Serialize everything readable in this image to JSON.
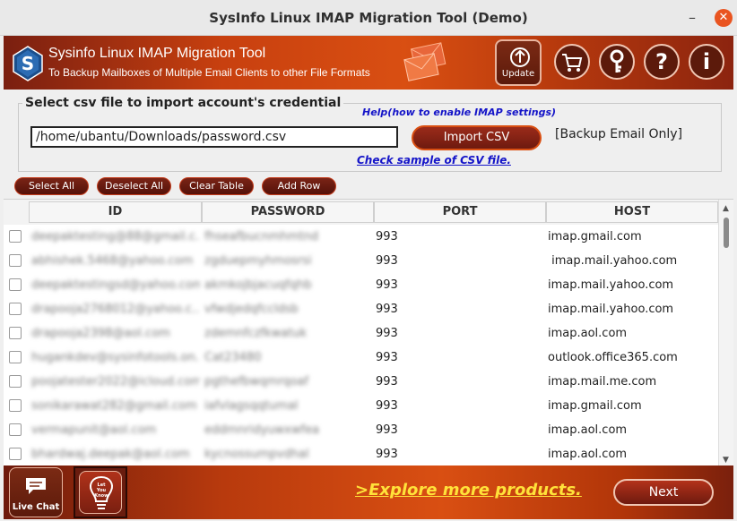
{
  "window": {
    "title": "SysInfo Linux IMAP Migration Tool (Demo)",
    "minimize_glyph": "–",
    "close_glyph": "✕"
  },
  "header": {
    "brand_title": "Sysinfo Linux IMAP Migration Tool",
    "brand_subtitle": "To Backup Mailboxes of Multiple Email Clients to other File Formats",
    "update_label": "Update",
    "cart_icon": "cart-icon",
    "key_icon": "key-icon",
    "help_icon": "help-icon",
    "info_icon": "info-icon",
    "help_glyph": "?",
    "info_glyph": "i"
  },
  "csv": {
    "group_title": "Select csv file to import account's credential",
    "help_link": "Help(how to enable IMAP settings)",
    "path_value": "/home/ubantu/Downloads/password.csv",
    "import_label": "Import CSV",
    "backup_label": "[Backup Email Only]",
    "sample_link": "Check sample of CSV file."
  },
  "actions": {
    "select_all": "Select All",
    "deselect_all": "Deselect All",
    "clear_table": "Clear Table",
    "add_row": "Add Row"
  },
  "table": {
    "columns": [
      "ID",
      "PASSWORD",
      "PORT",
      "HOST"
    ],
    "rows": [
      {
        "id": "deepaktesting@88@gmail.c...",
        "password": "fhseafbucnmhmtnd",
        "port": "993",
        "host": "imap.gmail.com"
      },
      {
        "id": "abhishek.5468@yahoo.com",
        "password": "zgduepmyhmosrsi",
        "port": "993",
        "host": " imap.mail.yahoo.com"
      },
      {
        "id": "deepaktestingsd@yahoo.com",
        "password": "akmkojbjacuqfqhb",
        "port": "993",
        "host": "imap.mail.yahoo.com"
      },
      {
        "id": "drapooja2768012@yahoo.c...",
        "password": "vfwdjedqfccldsb",
        "port": "993",
        "host": "imap.mail.yahoo.com"
      },
      {
        "id": "drapooja2398@aol.com",
        "password": "zdemnfczfkwatuk",
        "port": "993",
        "host": "imap.aol.com"
      },
      {
        "id": "hugankdev@sysinfotools.on...",
        "password": "Cat23480",
        "port": "993",
        "host": "outlook.office365.com"
      },
      {
        "id": "poojatester2022@icloud.com",
        "password": "pgthefbwqmrqoaf",
        "port": "993",
        "host": "imap.mail.me.com"
      },
      {
        "id": "sonikarawat282@gmail.com",
        "password": "iafvlagsqqtumal",
        "port": "993",
        "host": "imap.gmail.com"
      },
      {
        "id": "vermapunit@aol.com",
        "password": "eddmnridyuwxwfea",
        "port": "993",
        "host": "imap.aol.com"
      },
      {
        "id": "bhardwaj.deepak@aol.com",
        "password": "kycnossumpvdhal",
        "port": "993",
        "host": "imap.aol.com"
      }
    ]
  },
  "footer": {
    "live_chat_label": "Live Chat",
    "know_label_1": "Let",
    "know_label_2": "You",
    "know_label_3": "Know",
    "explore_link": ">Explore more products.",
    "next_label": "Next"
  },
  "colors": {
    "accent": "#d94f12",
    "dark_red": "#6e1a0f",
    "link_blue": "#1414c8",
    "explore_yellow": "#ffe23a"
  }
}
